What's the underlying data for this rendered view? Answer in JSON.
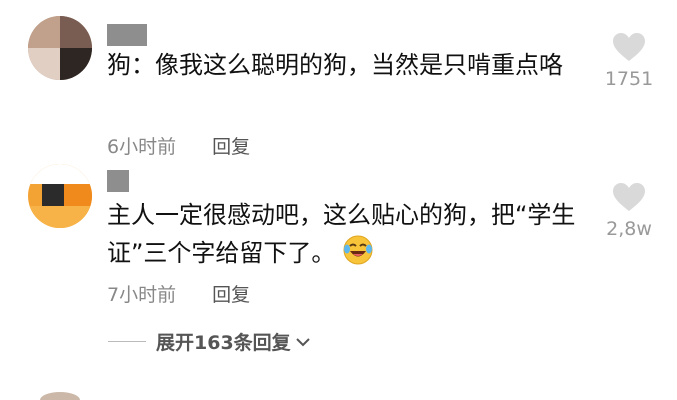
{
  "comments": [
    {
      "text": "狗：像我这么聪明的狗，当然是只啃重点咯",
      "time": "6小时前",
      "reply_label": "回复",
      "likes": "1751"
    },
    {
      "text_before_emoji": "主人一定很感动吧，这么贴心的狗，把“学生证”三个字给留下了。",
      "time": "7小时前",
      "reply_label": "回复",
      "likes": "2,8w",
      "emoji_icon": "laughing-crying-face-icon"
    }
  ],
  "expand_replies": "展开163条回复",
  "colors": {
    "text": "#111111",
    "meta": "#888888",
    "heart": "#d9d9d9",
    "username_placeholder": "#8e8e8e"
  }
}
